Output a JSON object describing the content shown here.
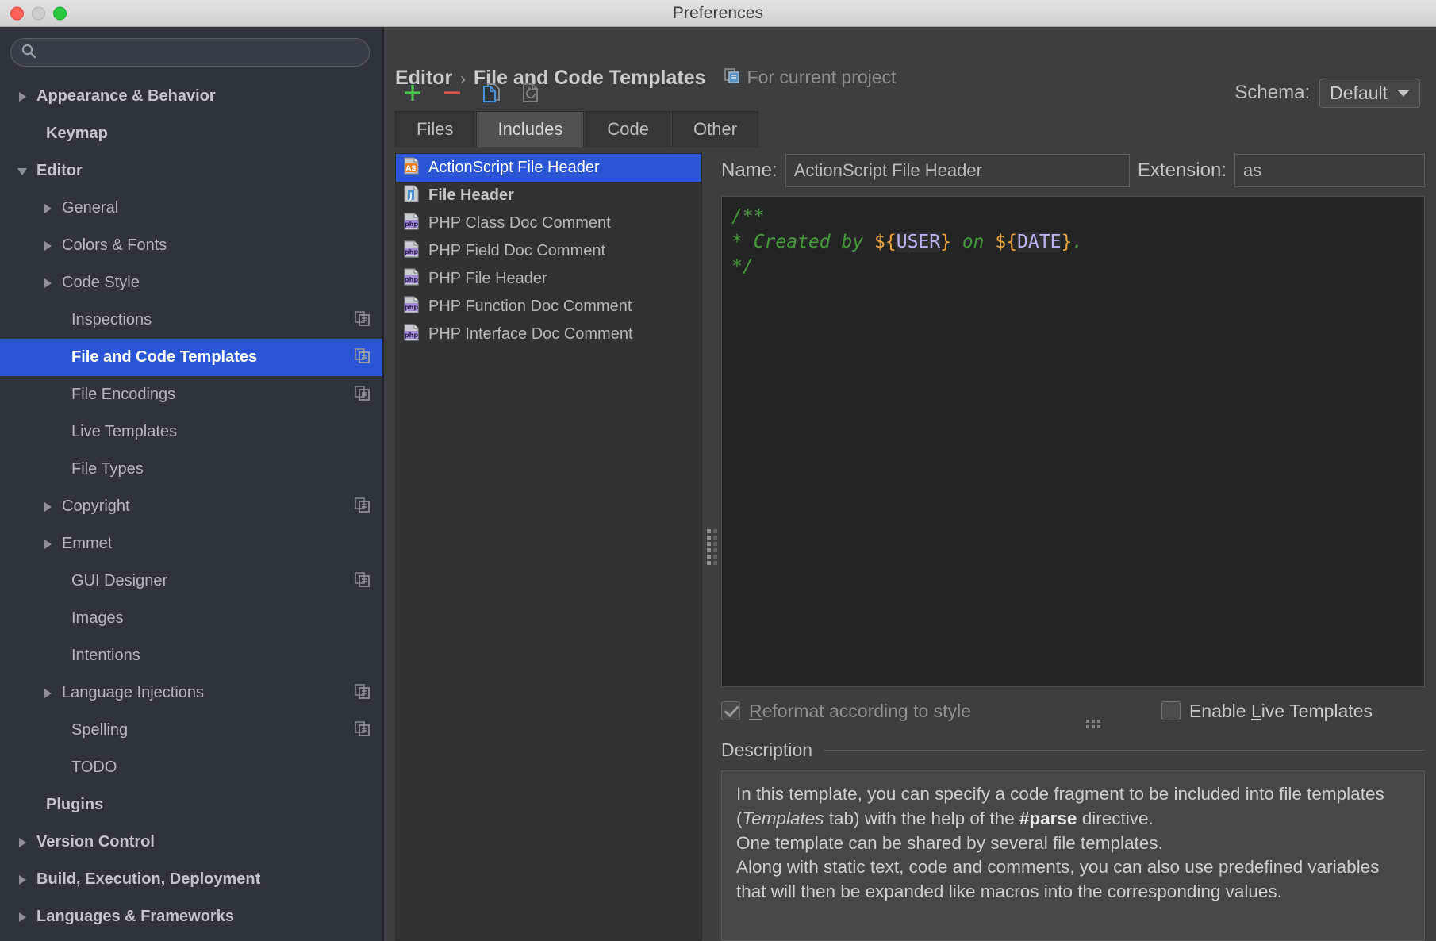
{
  "window": {
    "title": "Preferences"
  },
  "search": {
    "value": "",
    "placeholder": ""
  },
  "sidebar": {
    "items": [
      {
        "label": "Appearance & Behavior",
        "depth": 0,
        "arrow": "right",
        "bold": true,
        "badge": false,
        "selected": false
      },
      {
        "label": "Keymap",
        "depth": 0,
        "arrow": "none",
        "bold": true,
        "badge": false,
        "selected": false
      },
      {
        "label": "Editor",
        "depth": 0,
        "arrow": "down",
        "bold": true,
        "badge": false,
        "selected": false
      },
      {
        "label": "General",
        "depth": 1,
        "arrow": "right",
        "bold": false,
        "badge": false,
        "selected": false
      },
      {
        "label": "Colors & Fonts",
        "depth": 1,
        "arrow": "right",
        "bold": false,
        "badge": false,
        "selected": false
      },
      {
        "label": "Code Style",
        "depth": 1,
        "arrow": "right",
        "bold": false,
        "badge": false,
        "selected": false
      },
      {
        "label": "Inspections",
        "depth": 1,
        "arrow": "none",
        "bold": false,
        "badge": true,
        "selected": false
      },
      {
        "label": "File and Code Templates",
        "depth": 1,
        "arrow": "none",
        "bold": false,
        "badge": true,
        "selected": true
      },
      {
        "label": "File Encodings",
        "depth": 1,
        "arrow": "none",
        "bold": false,
        "badge": true,
        "selected": false
      },
      {
        "label": "Live Templates",
        "depth": 1,
        "arrow": "none",
        "bold": false,
        "badge": false,
        "selected": false
      },
      {
        "label": "File Types",
        "depth": 1,
        "arrow": "none",
        "bold": false,
        "badge": false,
        "selected": false
      },
      {
        "label": "Copyright",
        "depth": 1,
        "arrow": "right",
        "bold": false,
        "badge": true,
        "selected": false
      },
      {
        "label": "Emmet",
        "depth": 1,
        "arrow": "right",
        "bold": false,
        "badge": false,
        "selected": false
      },
      {
        "label": "GUI Designer",
        "depth": 1,
        "arrow": "none",
        "bold": false,
        "badge": true,
        "selected": false
      },
      {
        "label": "Images",
        "depth": 1,
        "arrow": "none",
        "bold": false,
        "badge": false,
        "selected": false
      },
      {
        "label": "Intentions",
        "depth": 1,
        "arrow": "none",
        "bold": false,
        "badge": false,
        "selected": false
      },
      {
        "label": "Language Injections",
        "depth": 1,
        "arrow": "right",
        "bold": false,
        "badge": true,
        "selected": false
      },
      {
        "label": "Spelling",
        "depth": 1,
        "arrow": "none",
        "bold": false,
        "badge": true,
        "selected": false
      },
      {
        "label": "TODO",
        "depth": 1,
        "arrow": "none",
        "bold": false,
        "badge": false,
        "selected": false
      },
      {
        "label": "Plugins",
        "depth": 0,
        "arrow": "none",
        "bold": true,
        "badge": false,
        "selected": false
      },
      {
        "label": "Version Control",
        "depth": 0,
        "arrow": "right",
        "bold": true,
        "badge": false,
        "selected": false
      },
      {
        "label": "Build, Execution, Deployment",
        "depth": 0,
        "arrow": "right",
        "bold": true,
        "badge": false,
        "selected": false
      },
      {
        "label": "Languages & Frameworks",
        "depth": 0,
        "arrow": "right",
        "bold": true,
        "badge": false,
        "selected": false
      }
    ]
  },
  "breadcrumb": {
    "parent": "Editor",
    "separator": "›",
    "current": "File and Code Templates",
    "scope": "For current project"
  },
  "toolbar": {
    "add_label": "+",
    "remove_label": "−",
    "copy_label": "Copy Template",
    "reset_label": "Reset To Default"
  },
  "schema": {
    "label": "Schema:",
    "value": "Default"
  },
  "tabs": [
    {
      "label": "Files",
      "active": false
    },
    {
      "label": "Includes",
      "active": true
    },
    {
      "label": "Code",
      "active": false
    },
    {
      "label": "Other",
      "active": false
    }
  ],
  "templates": [
    {
      "label": "ActionScript File Header",
      "icon": "as",
      "selected": true,
      "bold": false
    },
    {
      "label": "File Header",
      "icon": "ij",
      "selected": false,
      "bold": true
    },
    {
      "label": "PHP Class Doc Comment",
      "icon": "php",
      "selected": false,
      "bold": false
    },
    {
      "label": "PHP Field Doc Comment",
      "icon": "php",
      "selected": false,
      "bold": false
    },
    {
      "label": "PHP File Header",
      "icon": "php",
      "selected": false,
      "bold": false
    },
    {
      "label": "PHP Function Doc Comment",
      "icon": "php",
      "selected": false,
      "bold": false
    },
    {
      "label": "PHP Interface Doc Comment",
      "icon": "php",
      "selected": false,
      "bold": false
    }
  ],
  "detail": {
    "name_label": "Name:",
    "name_value": "ActionScript File Header",
    "extension_label": "Extension:",
    "extension_value": "as"
  },
  "editor": {
    "line1": "/**",
    "line2_a": " * Created by ",
    "line2_user_open": "${",
    "line2_user_name": "USER",
    "line2_user_close": "}",
    "line2_b": " on ",
    "line2_date_open": "${",
    "line2_date_name": "DATE",
    "line2_date_close": "}",
    "line2_c": ".",
    "line3": " */"
  },
  "options": {
    "reformat": {
      "label_before": "",
      "mnemonic": "R",
      "label_after": "eformat according to style",
      "checked": true,
      "enabled": false
    },
    "live_templates": {
      "label_before": "Enable ",
      "mnemonic": "L",
      "label_after": "ive Templates",
      "checked": false,
      "enabled": true
    }
  },
  "description": {
    "title": "Description",
    "p1_a": "In this template, you can specify a code fragment to be included into file templates (",
    "p1_em": "Templates",
    "p1_b": " tab) with the help of the ",
    "p1_strong": "#parse",
    "p1_c": " directive.",
    "p2": "One template can be shared by several file templates.",
    "p3": "Along with static text, code and comments, you can also use predefined variables that will then be expanded like macros into the corresponding values."
  },
  "colors": {
    "accent_selection": "#2a55d4",
    "comment_green": "#479a3c",
    "var_delim_orange": "#e8a33d",
    "var_name_purple": "#b8b6f0",
    "add_green": "#4fc24f",
    "remove_red": "#d4564f",
    "copy_blue": "#4a90d9"
  }
}
